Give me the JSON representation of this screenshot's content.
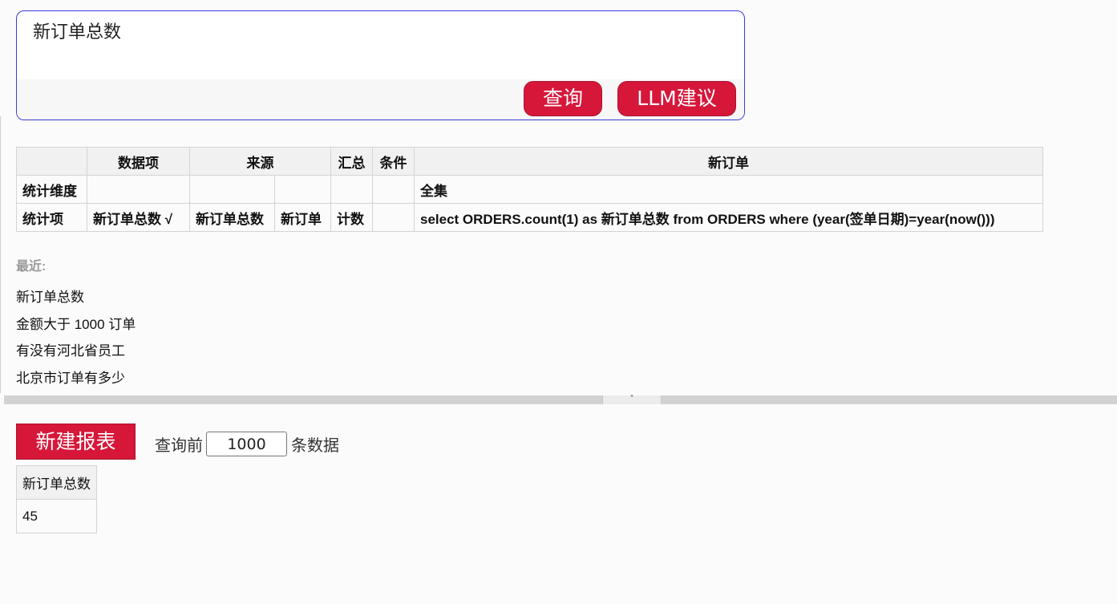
{
  "query": {
    "text": "新订单总数",
    "query_button": "查询",
    "llm_button": "LLM建议"
  },
  "stats_table": {
    "header": [
      "",
      "数据项",
      "来源",
      "汇总",
      "条件",
      "新订单"
    ],
    "dimension_row": {
      "label": "统计维度",
      "condition_value": "全集"
    },
    "item_row": {
      "label": "统计项",
      "data_item": "新订单总数 √",
      "source_field": "新订单总数",
      "source_table": "新订单",
      "aggregate": "计数",
      "condition": "",
      "sql": "select ORDERS.count(1) as 新订单总数 from ORDERS where (year(签单日期)=year(now()))"
    }
  },
  "recent": {
    "label": "最近:",
    "items": [
      "新订单总数",
      "金额大于 1000 订单",
      "有没有河北省员工",
      "北京市订单有多少"
    ]
  },
  "splitter": {
    "handle_icon": "chevron-up-icon",
    "handle_glyph": "˄"
  },
  "report": {
    "new_report_button": "新建报表",
    "limit_prefix": "查询前",
    "limit_value": "1000",
    "limit_suffix": "条数据"
  },
  "result_table": {
    "columns": [
      "新订单总数"
    ],
    "rows": [
      [
        "45"
      ]
    ]
  },
  "colors": {
    "accent_red": "#d6173a",
    "query_border": "#3a3ad8",
    "table_border": "#d4d4d4",
    "header_bg": "#f1f1f1"
  }
}
